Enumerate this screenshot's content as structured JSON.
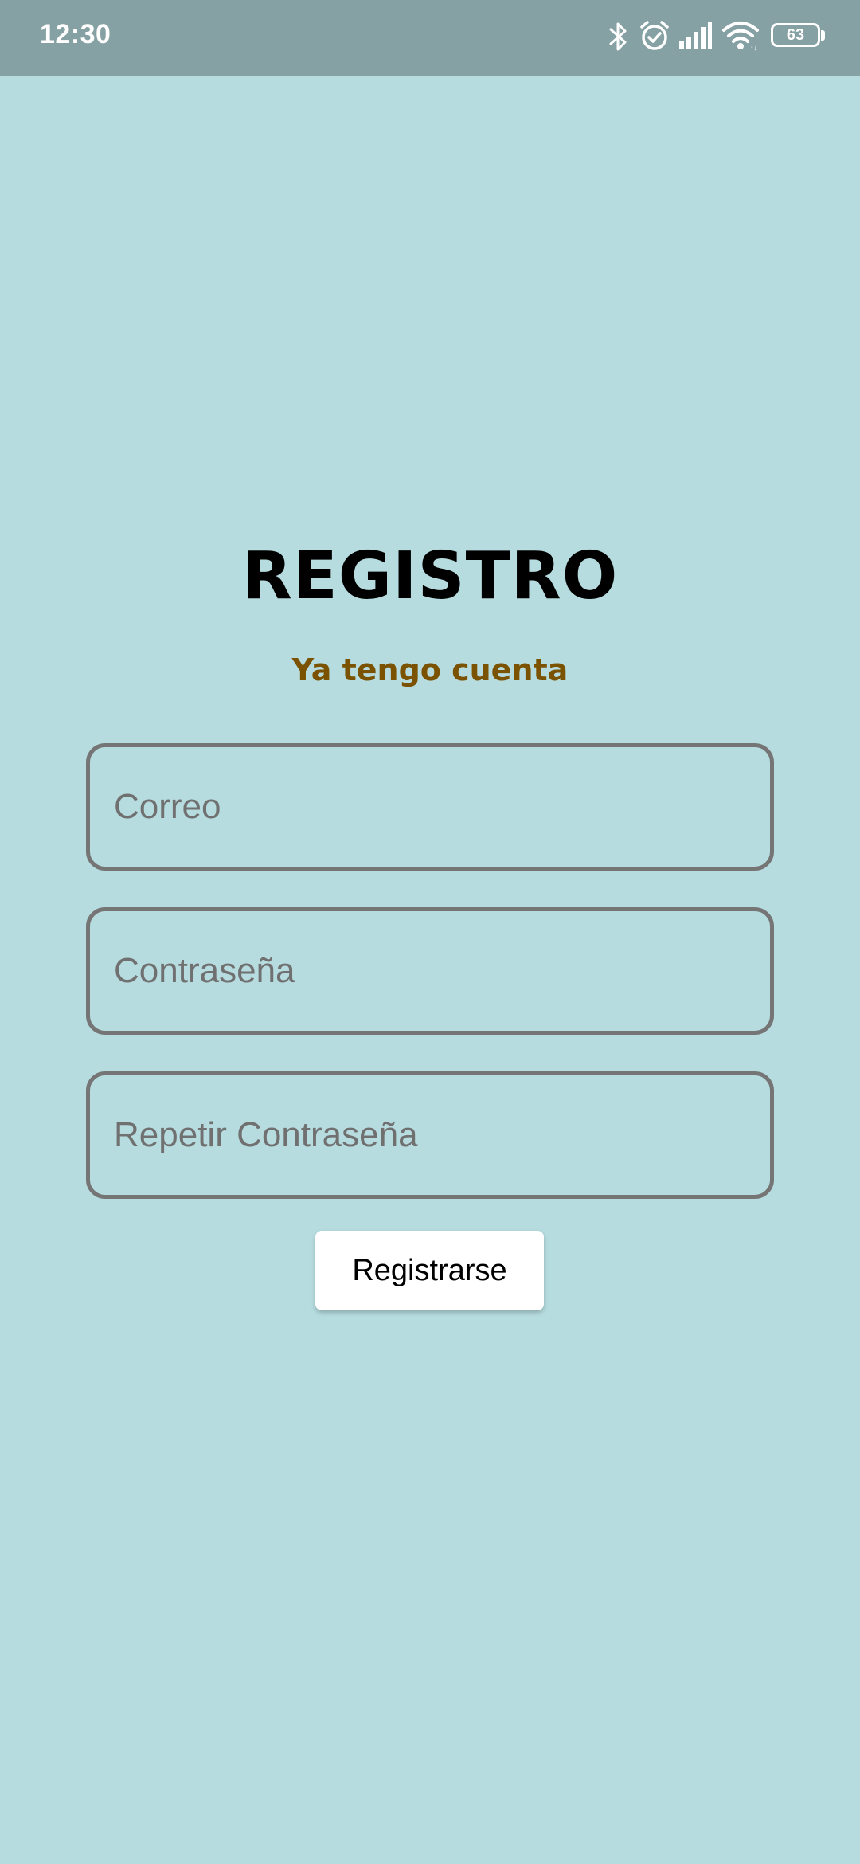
{
  "status_bar": {
    "time": "12:30",
    "icons": [
      "bluetooth-icon",
      "alarm-icon",
      "signal-icon",
      "wifi-icon",
      "battery-icon"
    ],
    "battery_level": "63"
  },
  "screen": {
    "title": "REGISTRO",
    "login_link": "Ya tengo cuenta",
    "fields": {
      "email": {
        "placeholder": "Correo",
        "value": ""
      },
      "password": {
        "placeholder": "Contraseña",
        "value": ""
      },
      "repeat_password": {
        "placeholder": "Repetir Contraseña",
        "value": ""
      }
    },
    "submit_label": "Registrarse"
  },
  "colors": {
    "background": "#b6dcdf",
    "status_bar": "#86a1a4",
    "link": "#7a5200",
    "field_border": "#757575",
    "button_background": "#ffffff"
  }
}
